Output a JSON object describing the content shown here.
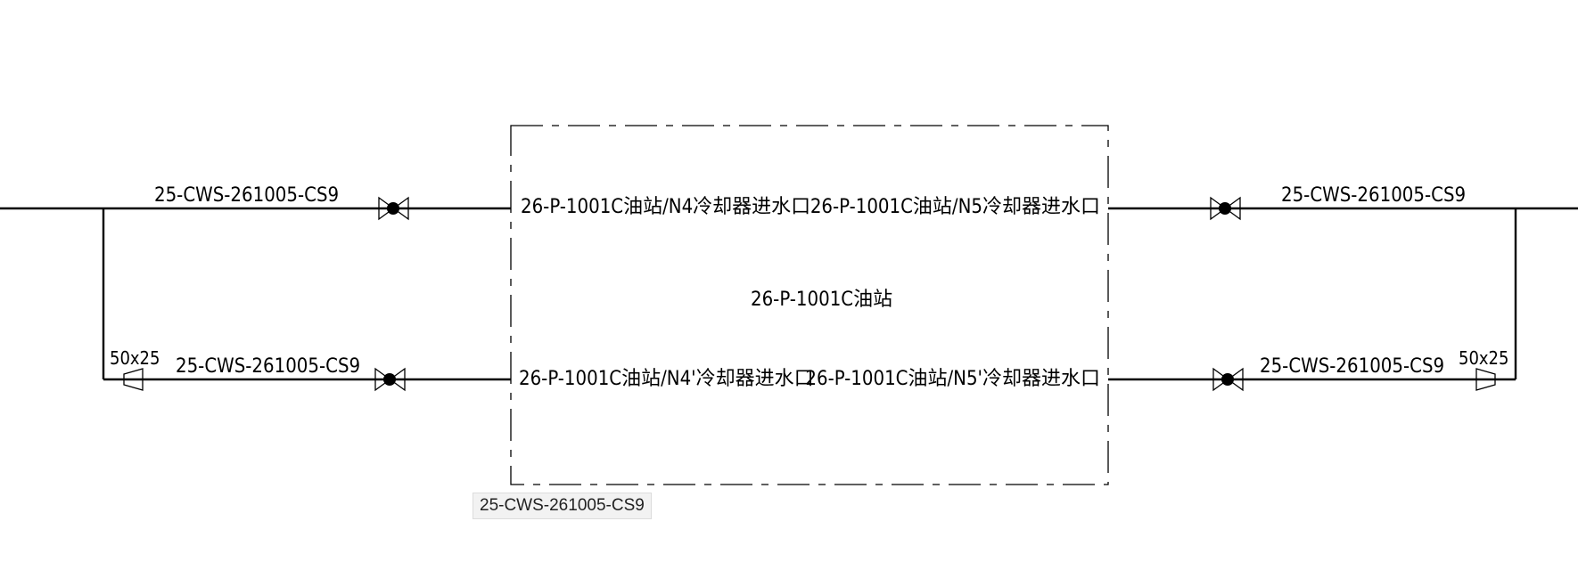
{
  "equipment": {
    "name": "26-P-1001C油站"
  },
  "nozzles": {
    "n4": "26-P-1001C油站/N4冷却器进水口",
    "n4p": "26-P-1001C油站/N4'冷却器进水口",
    "n5": "26-P-1001C油站/N5冷却器进水口",
    "n5p": "26-P-1001C油站/N5'冷却器进水口"
  },
  "lines": {
    "left_top": "25-CWS-261005-CS9",
    "left_bottom": "25-CWS-261005-CS9",
    "right_top": "25-CWS-261005-CS9",
    "right_bottom": "25-CWS-261005-CS9"
  },
  "reducers": {
    "left": "50x25",
    "right": "50x25"
  },
  "tooltip": {
    "text": "25-CWS-261005-CS9"
  }
}
